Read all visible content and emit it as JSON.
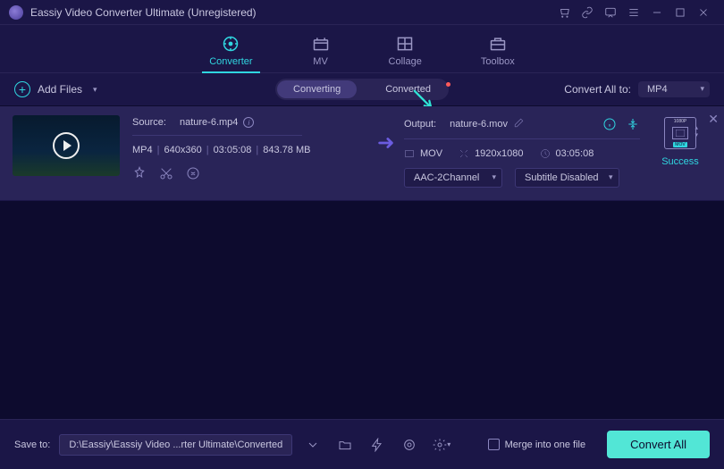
{
  "titlebar": {
    "title": "Eassiy Video Converter Ultimate (Unregistered)"
  },
  "nav": {
    "converter": "Converter",
    "mv": "MV",
    "collage": "Collage",
    "toolbox": "Toolbox"
  },
  "subbar": {
    "add_files": "Add Files",
    "converting": "Converting",
    "converted": "Converted",
    "convert_all_to": "Convert All to:",
    "format": "MP4"
  },
  "item": {
    "source_label": "Source:",
    "source_file": "nature-6.mp4",
    "src_format": "MP4",
    "src_res": "640x360",
    "src_dur": "03:05:08",
    "src_size": "843.78 MB",
    "output_label": "Output:",
    "output_file": "nature-6.mov",
    "out_format": "MOV",
    "out_res": "1920x1080",
    "out_dur": "03:05:08",
    "audio_sel": "AAC-2Channel",
    "sub_sel": "Subtitle Disabled",
    "thumb_label_top": "1080P",
    "thumb_label_bot": "MOV",
    "status": "Success"
  },
  "footer": {
    "saveto": "Save to:",
    "path": "D:\\Eassiy\\Eassiy Video ...rter Ultimate\\Converted",
    "merge": "Merge into one file",
    "convert_all": "Convert All"
  }
}
